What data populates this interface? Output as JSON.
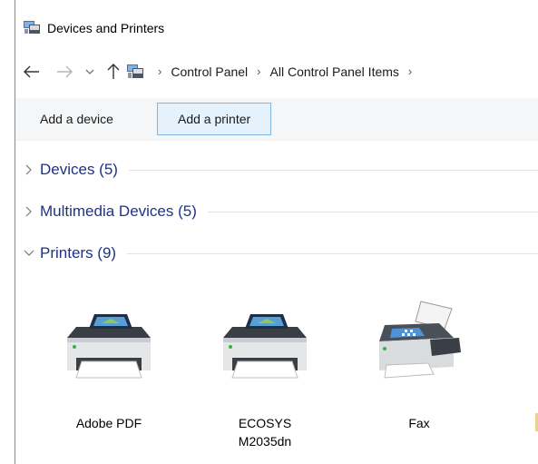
{
  "window": {
    "title": "Devices and Printers"
  },
  "address": {
    "crumbs": [
      "Control Panel",
      "All Control Panel Items"
    ],
    "separator": "›"
  },
  "commands": {
    "add_device": "Add a device",
    "add_printer": "Add a printer"
  },
  "groups": [
    {
      "label": "Devices (5)",
      "expanded": false
    },
    {
      "label": "Multimedia Devices (5)",
      "expanded": false
    },
    {
      "label": "Printers (9)",
      "expanded": true
    }
  ],
  "printers": [
    {
      "name": "Adobe PDF",
      "icon": "printer-icon"
    },
    {
      "name_line1": "ECOSYS",
      "name_line2": "M2035dn",
      "icon": "printer-icon"
    },
    {
      "name": "Fax",
      "icon": "fax-icon"
    }
  ],
  "colors": {
    "group_label": "#1e3287",
    "command_highlight_bg": "#e5f1fb",
    "command_highlight_border": "#7fb8e6"
  }
}
